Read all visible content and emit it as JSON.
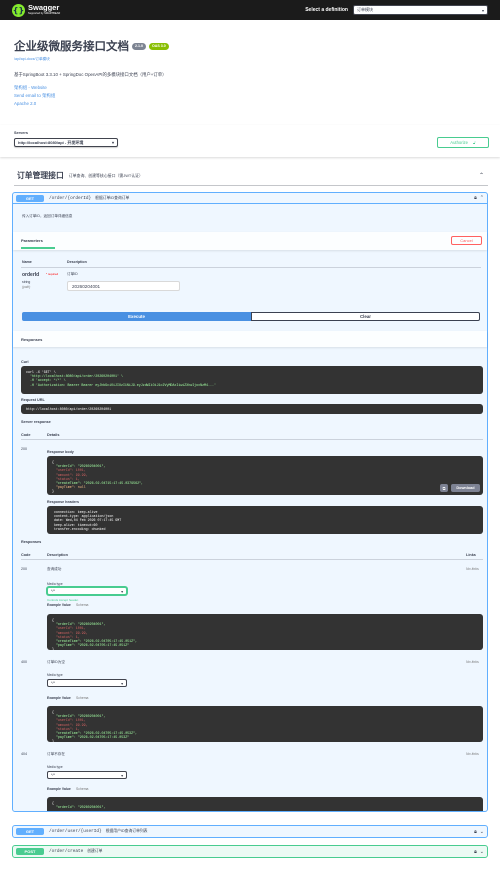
{
  "topbar": {
    "logo_name": "Swagger",
    "logo_sub": "Supported by SMARTBEAR",
    "def_label": "Select a definition",
    "def_value": "订单模块"
  },
  "info": {
    "title": "企业级微服务接口文档",
    "version": "2.1.0",
    "oas": "OAS 3.0",
    "url": "/api/api-docs/订单模块",
    "description": "基于SpringBoot 3.3.10 + SpringDoc OpenAPI的多模块接口文档（用户+订单）",
    "link_website": "架构组 - Website",
    "link_email": "Send email to 架构组",
    "link_license": "Apache 2.0"
  },
  "servers": {
    "label": "Servers",
    "selected": "http://localhost:8080/api - 开发环境",
    "authorize": "Authorize"
  },
  "tag": {
    "name": "订单管理接口",
    "description": "订单查询、创建等核心接口（需JWT认证）"
  },
  "op1": {
    "method": "GET",
    "path": "/order/{orderId}",
    "summary": "根据订单ID查询订单",
    "description": "传入订单ID，返回订单详细信息",
    "params_tab": "Parameters",
    "cancel": "Cancel",
    "col_name": "Name",
    "col_desc": "Description",
    "param_name": "orderId",
    "param_required": "* required",
    "param_type": "string",
    "param_in": "(path)",
    "param_label": "订单ID",
    "param_value": "20260204001",
    "execute": "Execute",
    "clear": "Clear",
    "responses_title": "Responses",
    "curl_label": "Curl",
    "curl_lines": [
      "curl -X 'GET' \\",
      "  'http://localhost:8080/api/order/20260204001' \\",
      "  -H 'accept: */*' \\",
      "  -H 'Authorization: Bearer Bearer eyJhbGciOiJIUzI1NiJ9.eyJzdWIiOiJ1c2VyMDAxIiwiZXhwIjoxNzM4...'"
    ],
    "request_url_label": "Request URL",
    "request_url": "http://localhost:8080/api/order/20260204001",
    "server_response_label": "Server response",
    "col_code": "Code",
    "col_details": "Details",
    "live_code": "200",
    "response_body_label": "Response body",
    "response_body_lines": [
      "{",
      "  \"orderId\": \"20260204001\",",
      "  \"userId\": 1001,",
      "  \"amount\": 99.99,",
      "  \"status\": 1,",
      "  \"createTime\": \"2026-02-04T15:17:45.0379562\",",
      "  \"payTime\": null",
      "}"
    ],
    "download": "Download",
    "response_headers_label": "Response headers",
    "response_headers_lines": [
      " connection: keep-alive",
      " content-type: application/json",
      " date: Wed,04 Feb 2026 07:17:45 GMT",
      " keep-alive: timeout=60",
      " transfer-encoding: chunked"
    ],
    "responses_label": "Responses",
    "col_links": "Links",
    "media_type_label": "Media type",
    "controls_accept": "Controls Accept header.",
    "example_value": "Example Value",
    "schema": "Schema",
    "no_links": "No links",
    "resp200": {
      "code": "200",
      "desc": "查询成功",
      "media": "*/*",
      "example_lines": [
        "{",
        "  \"orderId\": \"20260204001\",",
        "  \"userId\": 1001,",
        "  \"amount\": 99.99,",
        "  \"status\": 1,",
        "  \"createTime\": \"2026-02-04T05:17:45.051Z\",",
        "  \"payTime\": \"2026-02-04T05:17:45.051Z\"",
        "}"
      ]
    },
    "resp400": {
      "code": "400",
      "desc": "订单ID为空",
      "media": "*/*",
      "example_lines": [
        "{",
        "  \"orderId\": \"20260204001\",",
        "  \"userId\": 1001,",
        "  \"amount\": 99.99,",
        "  \"status\": 1,",
        "  \"createTime\": \"2026-02-04T05:17:45.053Z\",",
        "  \"payTime\": \"2026-02-04T05:17:45.053Z\"",
        "}"
      ]
    },
    "resp404": {
      "code": "404",
      "desc": "订单不存在",
      "media": "*/*",
      "example_lines": [
        "{",
        "  \"orderId\": \"20260204001\",",
        "  \"userId\": 1001,",
        "  \"amount\": 99.99,",
        "  \"status\": 1,",
        "  \"createTime\": \"2026-02-04T05:17:45.054Z\",",
        "  \"payTime\": \"2026-02-04T05:17:45.054Z\"",
        "}"
      ]
    }
  },
  "op2": {
    "method": "GET",
    "path": "/order/user/{userId}",
    "summary": "根据用户ID查询订单列表"
  },
  "op3": {
    "method": "POST",
    "path": "/order/create",
    "summary": "创建订单"
  },
  "colors": {
    "get": "#61affe",
    "post": "#49cc90",
    "execute": "#4990e2",
    "cancel": "#ff6060",
    "topbar": "#1b1b1b"
  }
}
